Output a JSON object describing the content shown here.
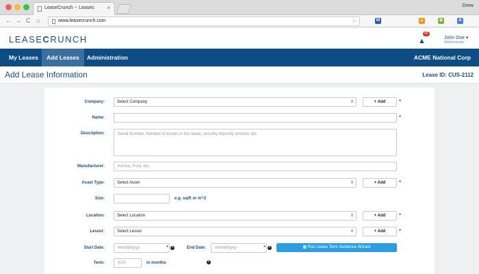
{
  "browser": {
    "tab_title": "LeaseCrunch -- Leases",
    "tab_close": "×",
    "profile": "Drew",
    "url": "www.leasecrunch.com",
    "nav_back": "←",
    "nav_forward": "→",
    "nav_reload": "C",
    "nav_home": "⌂",
    "url_star": "☆",
    "extensions": [
      {
        "label": "W",
        "color": "#2a5bb7"
      },
      {
        "label": "▲",
        "color": "#f39c12"
      },
      {
        "label": "⊕",
        "color": "#7fb53a"
      },
      {
        "label": "A",
        "color": "#4a7fd6"
      }
    ]
  },
  "header": {
    "logo_left": "LEASE",
    "logo_mark": "C",
    "logo_right": "RUNCH",
    "alert_count": "42",
    "bell_icon": "▲",
    "user_name": "John Doe ▾",
    "user_role": "Administrator"
  },
  "nav": {
    "items": [
      {
        "label": "My Leases"
      },
      {
        "label": "Add Leases"
      },
      {
        "label": "Administration"
      }
    ],
    "active_index": 1,
    "company": "ACME National Corp"
  },
  "page": {
    "title": "Add Lease Information",
    "lease_id": "Lease ID: CUS-2112"
  },
  "form": {
    "company_label": "Company:",
    "company_value": "Select Company",
    "name_label": "Name:",
    "description_label": "Description:",
    "description_placeholder": "Serial Number, Number of assets in this lease, security deposity amount, etc.",
    "manufacturer_label": "Manufacturer:",
    "manufacturer_placeholder": "Konica, Ford, etc.",
    "asset_type_label": "Asset Type:",
    "asset_type_value": "Select Asset",
    "size_label": "Size:",
    "size_hint": "e.g. sq/ft or m^2",
    "location_label": "Location:",
    "location_value": "Select Location",
    "lessor_label": "Lessor:",
    "lessor_value": "Select Lessor",
    "start_date_label": "Start Date:",
    "start_date_placeholder": "mm/dd/yyyy",
    "end_date_label": "End Date:",
    "end_date_placeholder": "mm/dd/yyyy",
    "term_label": "Term:",
    "term_placeholder": "XXX",
    "term_hint": "in months",
    "add_label": "+ Add",
    "required_mark": "*",
    "wizard_label": "▦ Run Lease Term Guidance Wizard",
    "select_caret": "⇕",
    "info_icon": "i"
  },
  "colors": {
    "brand": "#1b4e82",
    "nav_bg": "#0d4c84",
    "nav_active": "#3b6f9f",
    "wizard": "#2d9fe0"
  }
}
